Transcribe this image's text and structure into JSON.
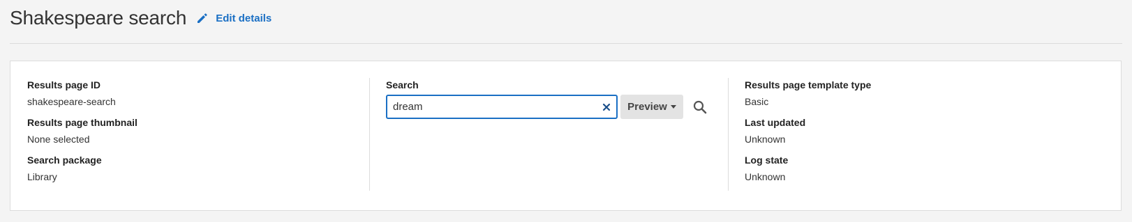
{
  "header": {
    "title": "Shakespeare search",
    "edit_label": "Edit details",
    "edit_icon": "pencil-icon",
    "accent_color": "#1a6fc4"
  },
  "details_left": {
    "results_page_id": {
      "label": "Results page ID",
      "value": "shakespeare-search"
    },
    "results_page_thumbnail": {
      "label": "Results page thumbnail",
      "value": "None selected"
    },
    "search_package": {
      "label": "Search package",
      "value": "Library"
    }
  },
  "search": {
    "label": "Search",
    "value": "dream",
    "clear_icon": "close-icon",
    "preview_label": "Preview",
    "preview_icon": "caret-down-icon",
    "submit_icon": "search-icon"
  },
  "details_right": {
    "template_type": {
      "label": "Results page template type",
      "value": "Basic"
    },
    "last_updated": {
      "label": "Last updated",
      "value": "Unknown"
    },
    "log_state": {
      "label": "Log state",
      "value": "Unknown"
    }
  }
}
